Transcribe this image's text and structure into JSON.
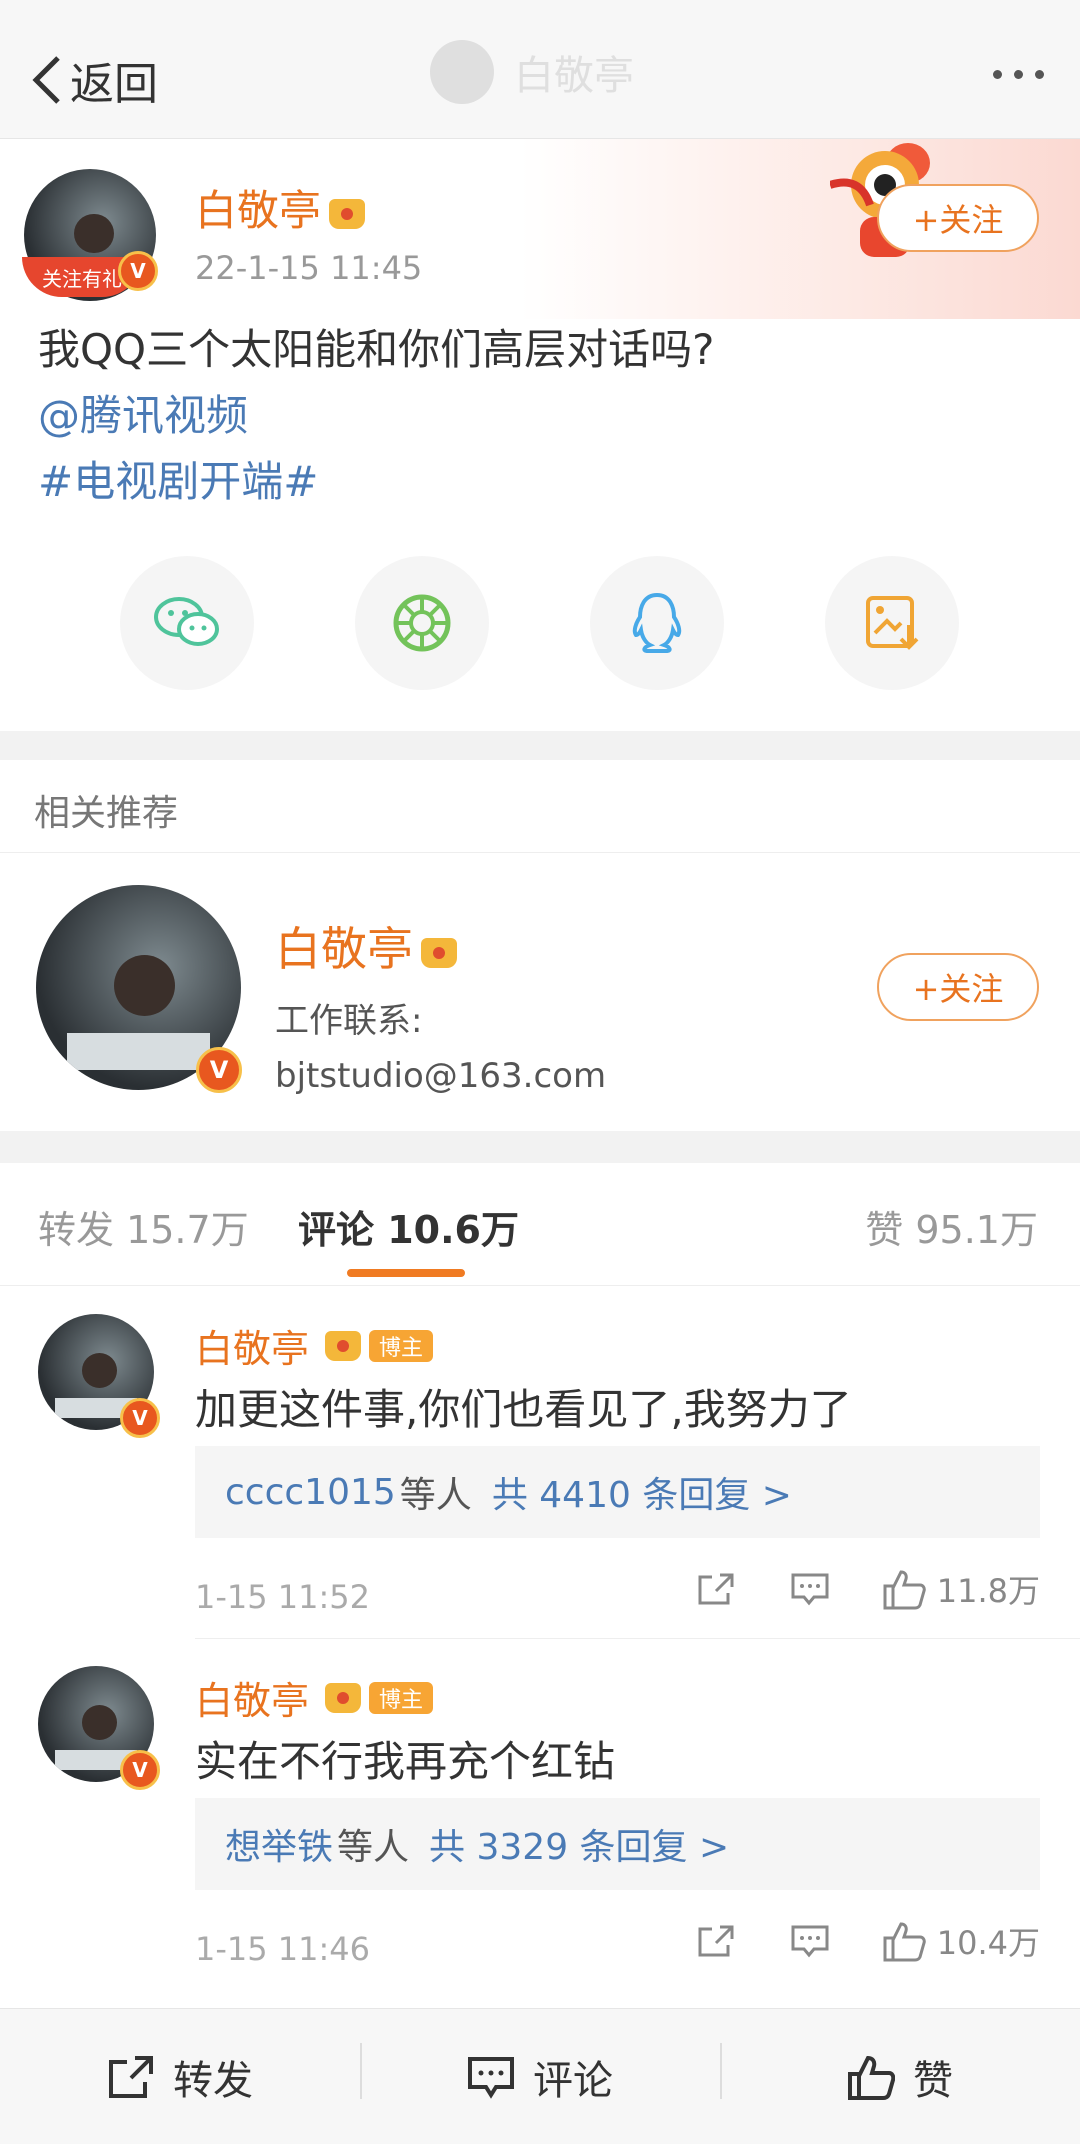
{
  "nav": {
    "back_label": "返回",
    "ghost_title": "白敬亭"
  },
  "post": {
    "author": "白敬亭",
    "time": "22-1-15 11:45",
    "avatar_ribbon": "关注有礼",
    "follow_label": "+关注",
    "text": "我QQ三个太阳能和你们高层对话吗?",
    "mention": "@腾讯视频",
    "topic": "#电视剧开端#",
    "share_icons": [
      "wechat-icon",
      "moments-icon",
      "qq-icon",
      "save-image-icon"
    ]
  },
  "related": {
    "heading": "相关推荐",
    "name": "白敬亭",
    "desc_line1": "工作联系:",
    "desc_line2": "bjtstudio@163.com",
    "follow_label": "+关注"
  },
  "tabs": {
    "repost": "转发 15.7万",
    "comment": "评论 10.6万",
    "like": "赞 95.1万"
  },
  "comments": [
    {
      "name": "白敬亭",
      "badge": "博主",
      "text": "加更这件事,你们也看见了,我努力了",
      "reply_user": "cccc1015",
      "reply_mid": "等人",
      "reply_count": "共 4410 条回复 >",
      "time": "1-15 11:52",
      "likes": "11.8万"
    },
    {
      "name": "白敬亭",
      "badge": "博主",
      "text": "实在不行我再充个红钻",
      "reply_user": "想举铁",
      "reply_mid": "等人",
      "reply_count": "共 3329 条回复 >",
      "time": "1-15 11:46",
      "likes": "10.4万"
    }
  ],
  "bottom": {
    "repost": "转发",
    "comment": "评论",
    "like": "赞"
  }
}
